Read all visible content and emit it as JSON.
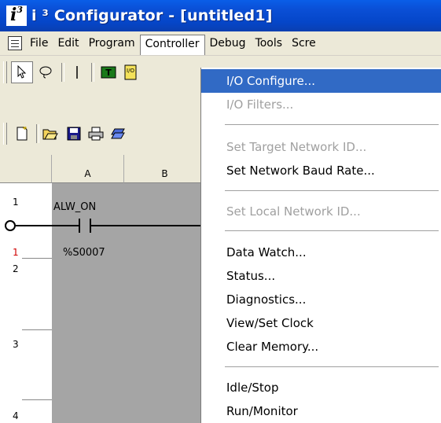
{
  "window": {
    "title": "i ³ Configurator - [untitled1]",
    "logo_text": "i",
    "logo_sup": "3"
  },
  "menubar": {
    "items": [
      "File",
      "Edit",
      "Program",
      "Controller",
      "Debug",
      "Tools",
      "Scre"
    ],
    "active": "Controller"
  },
  "toolbar1": {
    "icons": [
      "pointer-icon",
      "lasso-icon",
      "line-icon",
      "timer-icon",
      "io-icon"
    ]
  },
  "toolbar2": {
    "icons": [
      "new-icon",
      "open-icon",
      "save-icon",
      "print-icon",
      "layers-icon"
    ]
  },
  "ladder": {
    "columns": [
      "A",
      "B"
    ],
    "rows": [
      {
        "num": "1",
        "red": false
      },
      {
        "num": "1",
        "red": true
      },
      {
        "num": "2",
        "red": false
      },
      {
        "num": "3",
        "red": false
      },
      {
        "num": "4",
        "red": false
      }
    ],
    "contact_name": "ALW_ON",
    "contact_address": "%S0007"
  },
  "controller_menu": {
    "items": [
      {
        "label": "I/O Configure...",
        "state": "highlight"
      },
      {
        "label": "I/O Filters...",
        "state": "disabled"
      },
      {
        "label": "Set Target Network ID...",
        "state": "disabled"
      },
      {
        "label": "Set Network Baud Rate...",
        "state": "normal"
      },
      {
        "label": "Set Local Network ID...",
        "state": "disabled"
      },
      {
        "label": "Data Watch...",
        "state": "normal"
      },
      {
        "label": "Status...",
        "state": "normal"
      },
      {
        "label": "Diagnostics...",
        "state": "normal"
      },
      {
        "label": "View/Set Clock",
        "state": "normal"
      },
      {
        "label": "Clear Memory...",
        "state": "normal"
      },
      {
        "label": "Idle/Stop",
        "state": "normal"
      },
      {
        "label": "Run/Monitor",
        "state": "normal"
      }
    ]
  }
}
